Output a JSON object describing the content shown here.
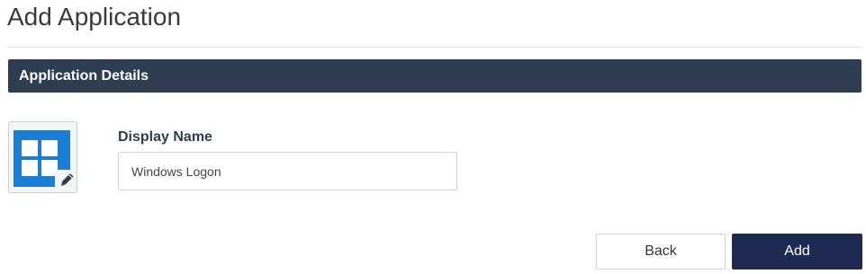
{
  "page": {
    "title": "Add Application"
  },
  "section": {
    "title": "Application Details"
  },
  "app_icon": {
    "icon": "windows-logo-icon",
    "edit_icon": "pencil-icon",
    "accent_color": "#1a7fd4"
  },
  "form": {
    "display_name_label": "Display Name",
    "display_name_value": "Windows Logon"
  },
  "actions": {
    "back_label": "Back",
    "add_label": "Add"
  },
  "colors": {
    "section_header_bg": "#2e3e50",
    "primary_button_bg": "#1e2a52"
  }
}
